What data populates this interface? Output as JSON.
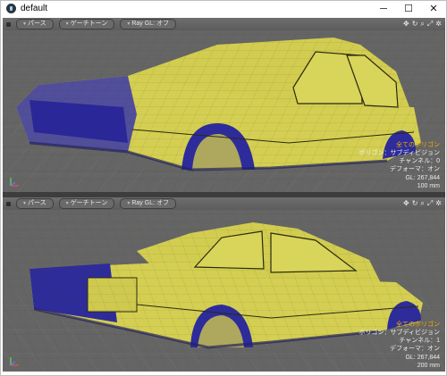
{
  "window": {
    "title": "default",
    "minimize": "─",
    "maximize": "☐",
    "close": "✕"
  },
  "viewports": [
    {
      "toolbar": {
        "view": "パース",
        "shading": "ゲーチトーン",
        "raygl": "Ray GL: オフ"
      },
      "icons": [
        "move-view-icon",
        "rotate-view-icon",
        "zoom-view-icon",
        "fit-view-icon",
        "settings-icon"
      ],
      "info": {
        "title": "全てのポリゴン",
        "polygon": "ポリゴン：サブディビジョン",
        "channel": "チャンネル：0",
        "deformer": "デフォーマ：オン",
        "gl": "GL: 267,844",
        "scale": "100 mm"
      }
    },
    {
      "toolbar": {
        "view": "パース",
        "shading": "ゲーチトーン",
        "raygl": "Ray GL: オフ"
      },
      "icons": [
        "move-view-icon",
        "rotate-view-icon",
        "zoom-view-icon",
        "fit-view-icon",
        "settings-icon"
      ],
      "info": {
        "title": "全てのポリゴン",
        "polygon": "ポリゴン：サブディビジョン",
        "channel": "チャンネル：1",
        "deformer": "デフォーマ：オン",
        "gl": "GL: 267,844",
        "scale": "200 mm"
      }
    }
  ],
  "colors": {
    "body": "#d4cf52",
    "shadow": "#2e2c9a",
    "viewport": "#646464",
    "info_title": "#f0b000"
  }
}
